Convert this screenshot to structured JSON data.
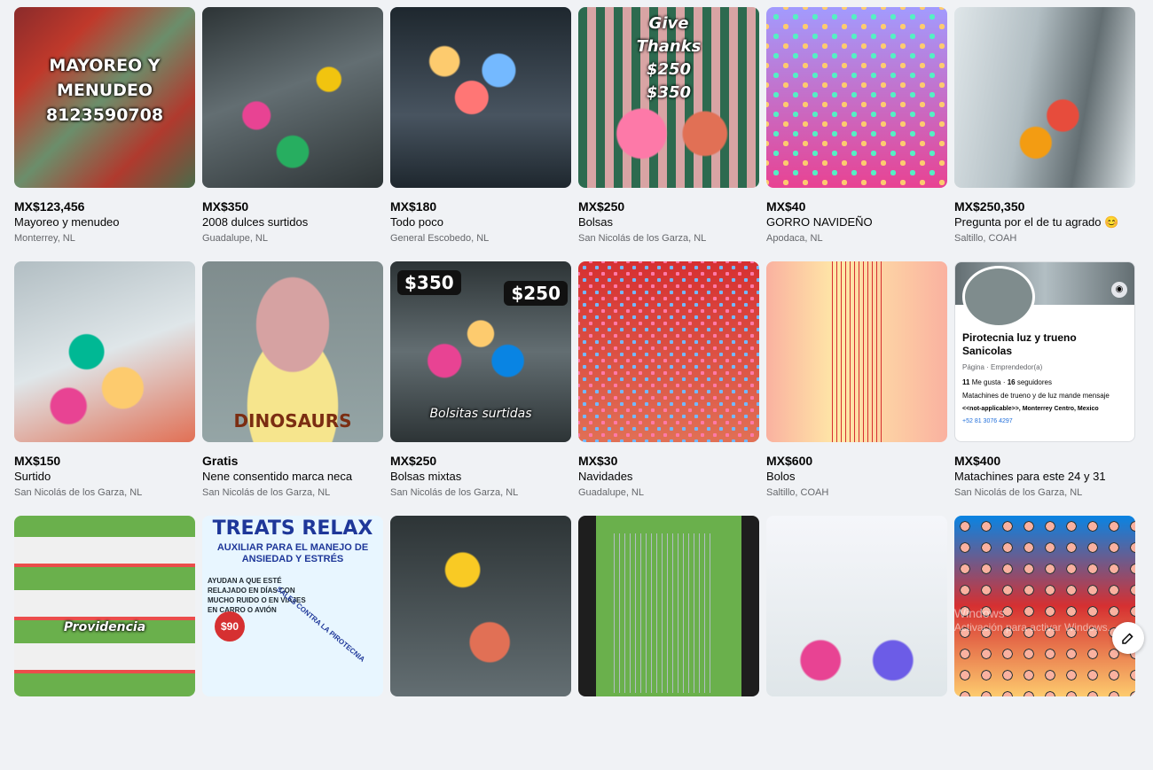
{
  "listings": [
    {
      "price": "MX$123,456",
      "title": "Mayoreo y menudeo",
      "location": "Monterrey, NL",
      "overlay": "MAYOREO Y MENUDEO 8123590708"
    },
    {
      "price": "MX$350",
      "title": "2008 dulces surtidos",
      "location": "Guadalupe, NL"
    },
    {
      "price": "MX$180",
      "title": "Todo poco",
      "location": "General Escobedo, NL"
    },
    {
      "price": "MX$250",
      "title": "Bolsas",
      "location": "San Nicolás de los Garza, NL",
      "overlay": "Give Thanks $250 $350"
    },
    {
      "price": "MX$40",
      "title": "GORRO NAVIDEÑO",
      "location": "Apodaca, NL"
    },
    {
      "price": "MX$250,350",
      "title": "Pregunta por el de tu agrado 😊",
      "location": "Saltillo, COAH"
    },
    {
      "price": "MX$150",
      "title": "Surtido",
      "location": "San Nicolás de los Garza, NL"
    },
    {
      "price": "Gratis",
      "title": "Nene consentido marca neca",
      "location": "San Nicolás de los Garza, NL",
      "overlay": "DINOSAURS"
    },
    {
      "price": "MX$250",
      "title": "Bolsas mixtas",
      "location": "San Nicolás de los Garza, NL",
      "badge1": "$350",
      "badge2": "$250",
      "caption": "Bolsitas surtidas"
    },
    {
      "price": "MX$30",
      "title": "Navidades",
      "location": "Guadalupe, NL"
    },
    {
      "price": "MX$600",
      "title": "Bolos",
      "location": "Saltillo, COAH"
    },
    {
      "price": "MX$400",
      "title": "Matachines para este 24 y 31",
      "location": "San Nicolás de los Garza, NL",
      "fb": {
        "name": "Pirotecnia luz y trueno Sanicolas",
        "category": "Página · Emprendedor(a)",
        "likes": "11",
        "likes_label": "Me gusta",
        "followers": "16",
        "followers_label": "seguidores",
        "about": "Matachines de trueno y de luz mande mensaje",
        "address": "<<not-applicable>>, Monterrey Centro, Mexico",
        "phone": "+52 81 3076 4297"
      }
    },
    {
      "price": "",
      "title": "",
      "location": "",
      "overlay": "Providencia"
    },
    {
      "price": "",
      "title": "",
      "location": "",
      "ad": {
        "title": "TREATS RELAX",
        "subtitle": "AUXILIAR PARA EL MANEJO DE ANSIEDAD Y ESTRÉS",
        "body": "AYUDAN A QUE ESTÉ RELAJADO EN DÍAS CON MUCHO RUIDO O EN VIAJES EN CARRO O AVIÓN",
        "price": "$90",
        "side": "SALES CONTRA LA PIROTECNIA"
      }
    },
    {
      "price": "",
      "title": "",
      "location": ""
    },
    {
      "price": "",
      "title": "",
      "location": ""
    },
    {
      "price": "",
      "title": "",
      "location": ""
    },
    {
      "price": "",
      "title": "",
      "location": ""
    }
  ],
  "watermark": {
    "line1": "Windows",
    "line2": "Activación para activar Windows."
  },
  "colors": {
    "background": "#f0f2f5",
    "text": "#050505",
    "secondary": "#65676b"
  },
  "icons": {
    "fab": "compose-icon",
    "camera": "camera-icon"
  }
}
